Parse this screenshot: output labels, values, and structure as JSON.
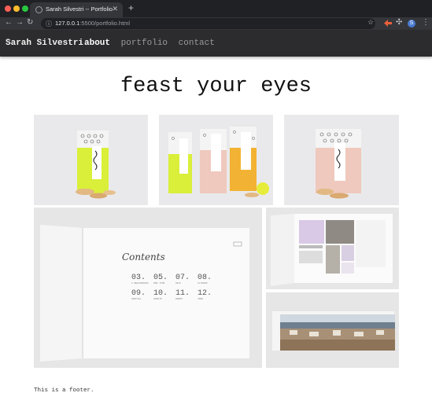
{
  "browser": {
    "tab_title": "Sarah Silvestri -- Portfolio",
    "url_host": "127.0.0.1",
    "url_rest": ":5500/portfolio.html",
    "profile_initial": "S"
  },
  "site": {
    "brand": "Sarah Silvestri",
    "nav": [
      "about",
      "portfolio",
      "contact"
    ],
    "active_nav": "about",
    "heading": "feast your eyes",
    "footer": "This is a footer."
  },
  "booklet": {
    "title": "Contents",
    "entries": [
      {
        "num": "03.",
        "label": "A BEGINNINGS"
      },
      {
        "num": "05.",
        "label": "ONE TIME"
      },
      {
        "num": "07.",
        "label": "SELF"
      },
      {
        "num": "08.",
        "label": "ALTERED"
      },
      {
        "num": "09.",
        "label": "SPECIAL"
      },
      {
        "num": "10.",
        "label": "GRANTS"
      },
      {
        "num": "11.",
        "label": "WORKS"
      },
      {
        "num": "12.",
        "label": "CRED"
      }
    ]
  },
  "colors": {
    "chrome_dark": "#202124",
    "chrome_tab": "#35363a",
    "nav_bg": "#2c2c2e",
    "accent_lime": "#d9ef3a",
    "accent_pink": "#efc9bd",
    "accent_orange": "#f2b233"
  }
}
